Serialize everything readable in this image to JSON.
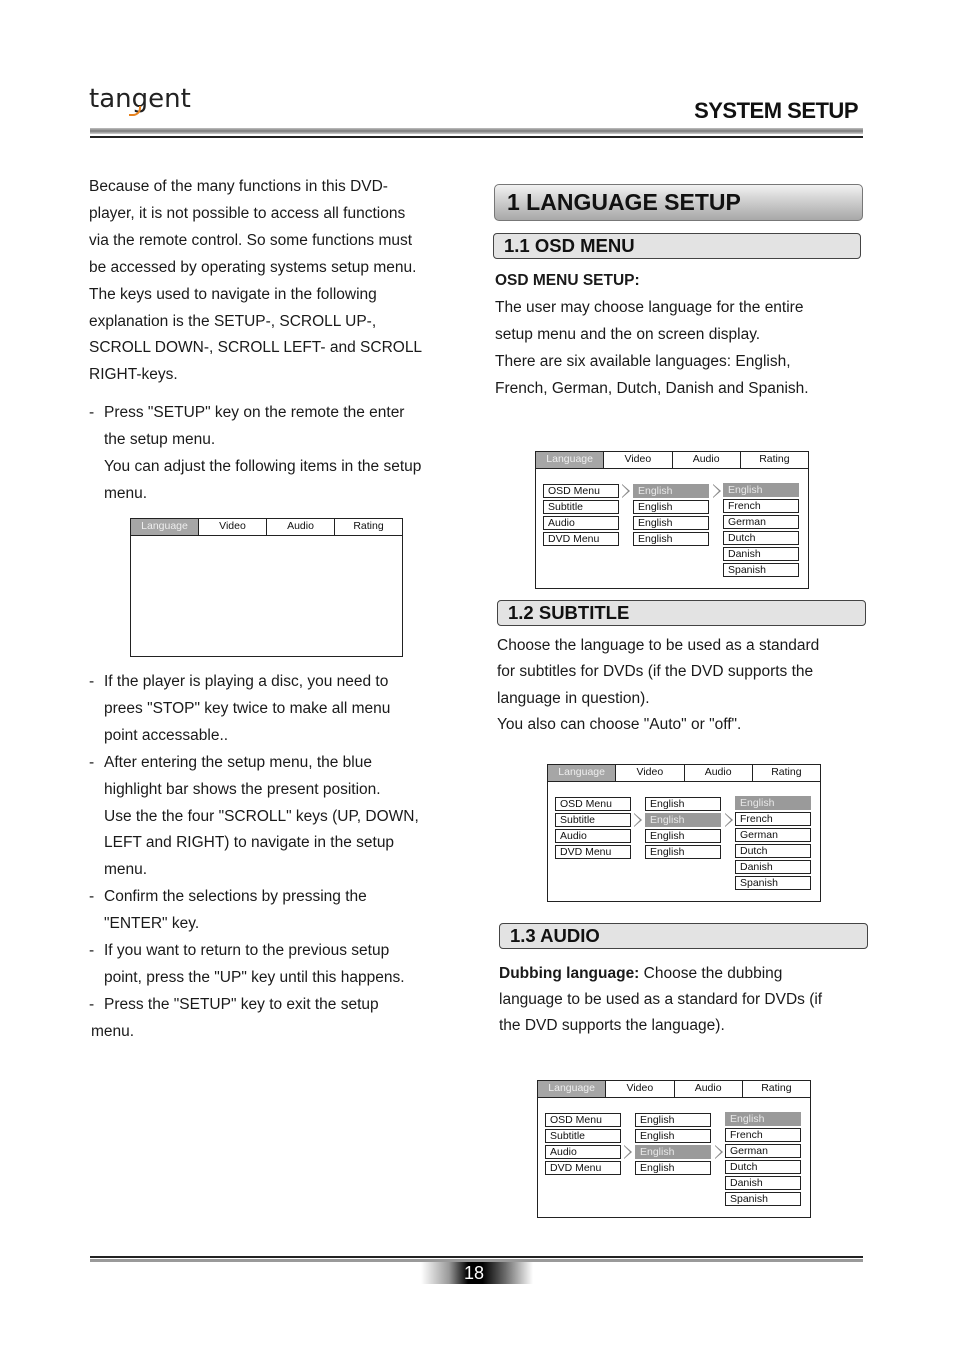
{
  "header": {
    "brand": "tangent",
    "section_title": "SYSTEM SETUP",
    "brand_accent_color": "#e8821e"
  },
  "left": {
    "intro": [
      "Because of the many functions in this DVD-",
      "player, it is not possible to access all functions",
      "via the remote control. So some functions must",
      "be accessed by operating systems setup menu.",
      "The keys used to navigate in the following",
      "explanation is the SETUP-, SCROLL UP-,",
      "SCROLL DOWN-, SCROLL LEFT- and SCROLL",
      "RIGHT-keys."
    ],
    "bullet1": {
      "dash": "-",
      "lines": [
        "Press \"SETUP\" key on the remote the enter",
        "the setup menu.",
        "You can adjust the following items in the setup",
        "menu."
      ]
    },
    "bullets2": [
      {
        "dash": "-",
        "lines": [
          "If the player is playing a disc, you need to",
          "prees \"STOP\" key twice to make all menu",
          "point accessable.."
        ]
      },
      {
        "dash": "-",
        "lines": [
          "After entering the setup menu, the blue",
          "highlight bar shows the present position.",
          "Use the the four \"SCROLL\" keys (UP, DOWN,",
          "LEFT and RIGHT) to navigate in the setup",
          "menu."
        ]
      },
      {
        "dash": "-",
        "lines": [
          "Confirm the selections by pressing the",
          "\"ENTER\" key."
        ]
      },
      {
        "dash": "-",
        "lines": [
          "If you want to return to the previous setup",
          "point, press the \"UP\" key until this happens."
        ]
      },
      {
        "dash": "-",
        "lines": [
          "Press the \"SETUP\" key to exit the setup"
        ]
      }
    ],
    "trailing_line": "menu."
  },
  "osd_tabs": [
    "Language",
    "Video",
    "Audio",
    "Rating"
  ],
  "osd_menu_items": [
    "OSD Menu",
    "Subtitle",
    "Audio",
    "DVD Menu"
  ],
  "osd_current_values": [
    "English",
    "English",
    "English",
    "English"
  ],
  "osd_language_options": [
    "English",
    "French",
    "German",
    "Dutch",
    "Danish",
    "Spanish"
  ],
  "right": {
    "main_heading": "1 LANGUAGE SETUP",
    "osd_section": {
      "heading": "1.1 OSD MENU",
      "subheading": "OSD MENU SETUP:",
      "lines": [
        "The user may choose language for the entire",
        "setup menu and the on screen display.",
        "There are six available languages: English,",
        "French, German, Dutch, Danish and Spanish."
      ],
      "selected_menu_index": 0,
      "selected_option": "English"
    },
    "subtitle_section": {
      "heading": "1.2 SUBTITLE",
      "lines": [
        "Choose the language to be used as a standard",
        "for subtitles for DVDs (if the DVD supports the",
        "language in question).",
        "You also can choose \"Auto\" or \"off\"."
      ],
      "selected_menu_index": 1,
      "selected_option": "English"
    },
    "audio_section": {
      "heading": "1.3 AUDIO",
      "bold_lead": "Dubbing language:",
      "line1_rest": " Choose the dubbing",
      "lines": [
        "language to be used as a standard for DVDs (if",
        "the DVD supports the language)."
      ],
      "selected_menu_index": 2,
      "selected_option": "English"
    }
  },
  "footer": {
    "page_number": "18"
  }
}
